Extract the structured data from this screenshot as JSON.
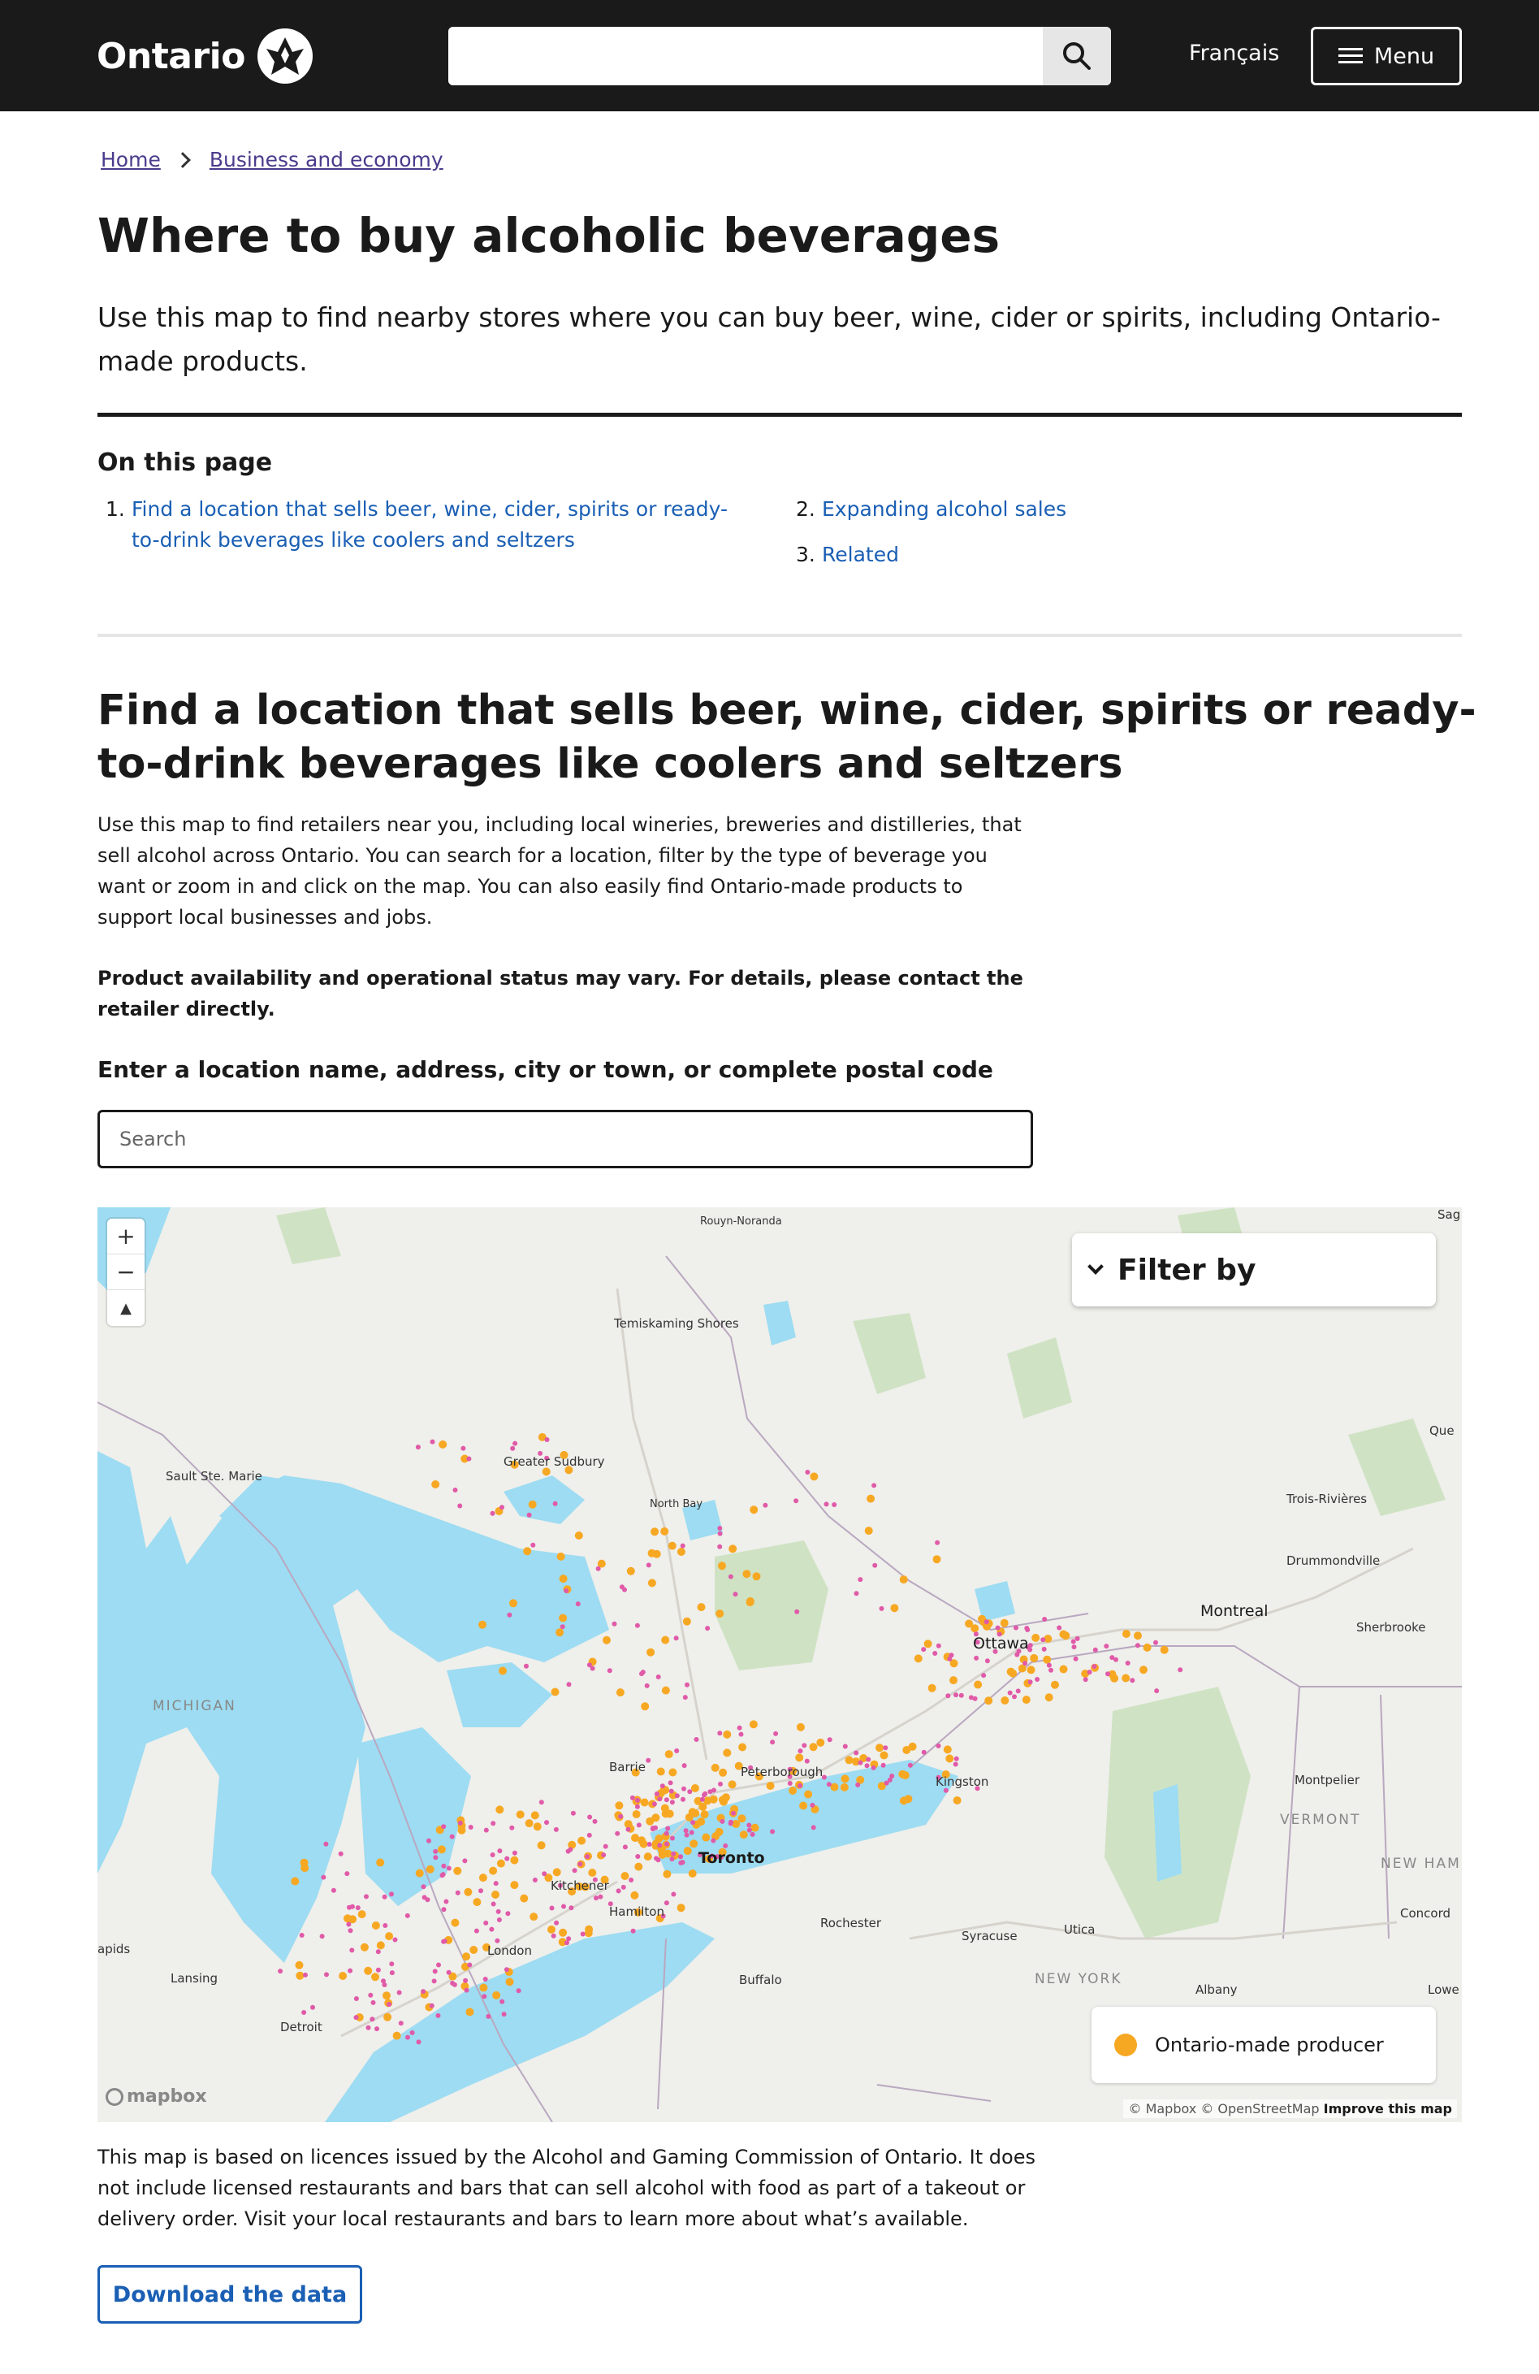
{
  "header": {
    "logo_text": "Ontario",
    "search_placeholder": "",
    "language_link": "Français",
    "menu_label": "Menu"
  },
  "breadcrumb": [
    "Home",
    "Business and economy"
  ],
  "page": {
    "title": "Where to buy alcoholic beverages",
    "lead": "Use this map to find nearby stores where you can buy beer, wine, cider or spirits, including Ontario-made products."
  },
  "on_this_page": {
    "heading": "On this page",
    "items": [
      {
        "num": "1.",
        "label": "Find a location that sells beer, wine, cider, spirits or ready-to-drink beverages like coolers and seltzers"
      },
      {
        "num": "2.",
        "label": "Expanding alcohol sales"
      },
      {
        "num": "3.",
        "label": "Related"
      }
    ]
  },
  "section": {
    "title": "Find a location that sells beer, wine, cider, spirits or ready-to-drink beverages like coolers and seltzers",
    "intro": "Use this map to find retailers near you, including local wineries, breweries and distilleries, that sell alcohol across Ontario. You can search for a location, filter by the type of beverage you want or zoom in and click on the map. You can also easily find Ontario-made products to support local businesses and jobs.",
    "notice": "Product availability and operational status may vary. For details, please contact the retailer directly.",
    "search_label": "Enter a location name, address, city or town, or complete postal code",
    "search_placeholder": "Search"
  },
  "map": {
    "filter_label": "Filter by",
    "legend_label": "Ontario-made producer",
    "legend_color": "#f7a823",
    "retailer_color": "#e05aa8",
    "water_color": "#9ddcf2",
    "land_color": "#efefeb",
    "park_color": "#cfe3c4",
    "mapbox_logo": "mapbox",
    "attribution": "© Mapbox © OpenStreetMap",
    "attribution_link": "Improve this map",
    "zoom_in": "+",
    "zoom_out": "−",
    "compass": "▲",
    "places": [
      "Rouyn-Noranda",
      "Temiskaming Shores",
      "Greater Sudbury",
      "North Bay",
      "Sault Ste. Marie",
      "Ottawa",
      "Montreal",
      "Trois-Rivières",
      "Drummondville",
      "Sherbrooke",
      "Que",
      "Barrie",
      "Peterborough",
      "Kingston",
      "Toronto",
      "Kitchener",
      "Hamilton",
      "London",
      "Rochester",
      "Syracuse",
      "Utica",
      "Buffalo",
      "Detroit",
      "Lansing",
      "apids",
      "Montpelier",
      "Concord",
      "Albany",
      "Lowe",
      "Sag",
      "MICHIGAN",
      "VERMONT",
      "NEW HAMPSHIR",
      "NEW YORK"
    ]
  },
  "footnote": "This map is based on licences issued by the Alcohol and Gaming Commission of Ontario. It does not include licensed restaurants and bars that can sell alcohol with food as part of a takeout or delivery order. Visit your local restaurants and bars to learn more about what’s available.",
  "download_label": "Download the data"
}
